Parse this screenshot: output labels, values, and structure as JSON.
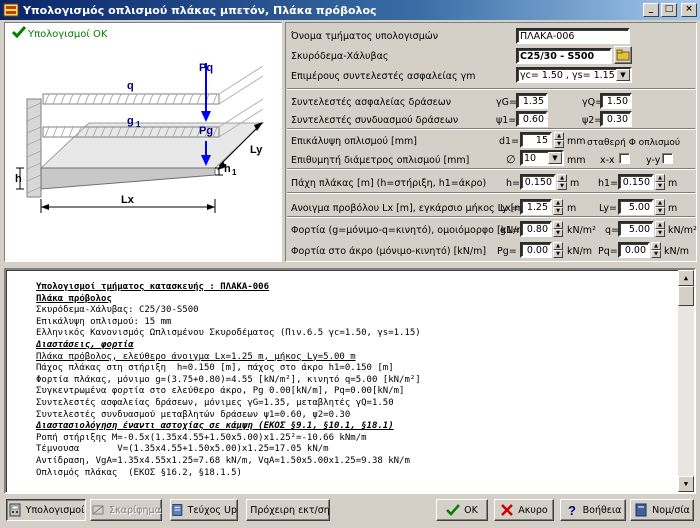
{
  "window": {
    "title": "Υπολογισμός οπλισμού πλάκας μπετόν, Πλάκα πρόβολος",
    "minimize_glyph": "_",
    "maximize_glyph": "□",
    "close_glyph": "×"
  },
  "status": {
    "ok_label": "Υπολογισμοί ΟΚ"
  },
  "diagram": {
    "labels": {
      "pq": "Pq",
      "q": "q",
      "g1": "g",
      "g1_sub": "1",
      "pg": "Pg",
      "h": "h",
      "h1": "h",
      "h1_sub": "1",
      "ly": "Ly",
      "lx": "Lx"
    }
  },
  "form": {
    "section_name": {
      "label": "Όνομα τμήματος υπολογισμών",
      "value": "ΠΛΑΚΑ-006"
    },
    "concrete_steel": {
      "label": "Σκυρόδεμα-Χάλυβας",
      "value": "C25/30 - S500"
    },
    "safety_factors": {
      "label": "Επιμέρους συντελεστές ασφαλείας γm",
      "value": "γc= 1.50 , γs= 1.15"
    },
    "load_safety": {
      "label": "Συντελεστές ασφαλείας δράσεων",
      "gG_label": "γG=",
      "gG": "1.35",
      "gQ_label": "γQ=",
      "gQ": "1.50"
    },
    "combination": {
      "label": "Συντελεστές συνδυασμού δράσεων",
      "psi1_label": "ψ1=",
      "psi1": "0.60",
      "psi2_label": "ψ2=",
      "psi2": "0.30"
    },
    "cover": {
      "label": "Επικάλυψη οπλισμού [mm]",
      "d1_label": "d1=",
      "d1": "15",
      "unit": "mm"
    },
    "diameter": {
      "label": "Επιθυμητή διάμετρος οπλισμού [mm]",
      "symbol": "∅",
      "value": "10",
      "unit": "mm"
    },
    "constant_diam": {
      "label": "σταθερή Φ οπλισμού",
      "xx_label": "x-x",
      "yy_label": "y-y"
    },
    "thickness": {
      "label": "Πάχη πλάκας [m] (h=στήριξη, h1=άκρο)",
      "h_label": "h=",
      "h": "0.150",
      "h1_label": "h1=",
      "h1": "0.150",
      "unit": "m"
    },
    "span": {
      "label": "Ανοιγμα προβόλου Lx [m],   εγκάρσιο μήκος Ly [m]",
      "lx_label": "Lx=",
      "lx": "1.25",
      "ly_label": "Ly=",
      "ly": "5.00",
      "unit": "m"
    },
    "loads": {
      "label": "Φορτία (g=μόνιμο-q=κινητό), ομοιόμορφο [kN/m²]",
      "g1_label": "g1=",
      "g1": "0.80",
      "q_label": "q=",
      "q": "5.00",
      "unit": "kN/m²"
    },
    "tip_loads": {
      "label": "Φορτία στο άκρο (μόνιμο-κινητό) [kN/m]",
      "pg_label": "Pg=",
      "pg": "0.00",
      "pq_label": "Pq=",
      "pq": "0.00",
      "unit": "kN/m"
    }
  },
  "report": {
    "lines": [
      "Υπολογισμοί τμήματος κατασκευής : ΠΛΑΚΑ-006",
      "Πλάκα πρόβολος",
      "Σκυρόδεμα-Χάλυβας: C25/30-S500",
      "Επικάλυψη οπλισμού: 15 mm",
      "Ελληνικός Κανονισμός Ωπλισμένου Σκυροδέματος (Πιν.6.5 γc=1.50, γs=1.15)",
      "Διαστάσεις, φορτία",
      "Πλάκα πρόβολος, ελεύθερο άνοιγμα Lx=1.25 m, μήκος Ly=5.00 m",
      "Πάχος πλάκας στη στήριξη  h=0.150 [m], πάχος στο άκρο h1=0.150 [m]",
      "Φορτία πλάκας, μόνιμο g=(3.75+0.80)=4.55 [kN/m²], κινητό q=5.00 [kN/m²]",
      "Συγκεντρωμένα φορτία στο ελεύθερο άκρο, Pg 0.00[kN/m], Pq=0.00[kN/m]",
      "Συντελεστές ασφαλείας δράσεων, μόνιμες γG=1.35, μεταβλητές γQ=1.50",
      "Συντελεστές συνδυασμού μεταβλητών δράσεων ψ1=0.60, ψ2=0.30",
      "Διαστασιολόγηση έναντι αστοχίας σε κάμψη (ΕΚΟΣ §9.1, §10.1, §18.1)",
      "Ροπή στήριξης M=-0.5x(1.35x4.55+1.50x5.00)x1.25²=-10.66 kNm/m",
      "Τέμνουσα       V=(1.35x4.55+1.50x5.00)x1.25=17.05 kN/m",
      "Αντίδραση, VgA=1.35x4.55x1.25=7.68 kN/m, VqA=1.50x5.00x1.25=9.38 kN/m",
      "Οπλισμός πλάκας  (ΕΚΟΣ §16.2, §18.1.5)"
    ]
  },
  "buttons": {
    "calc": "Υπολογισμοί",
    "draw": "Σκαρίφημα",
    "teuxos": "Τεύχος Up",
    "preview": "Πρόχειρη εκτ/ση",
    "ok": "OK",
    "cancel": "Ακυρο",
    "help": "Βοήθεια",
    "close": "Νομ/σία"
  }
}
